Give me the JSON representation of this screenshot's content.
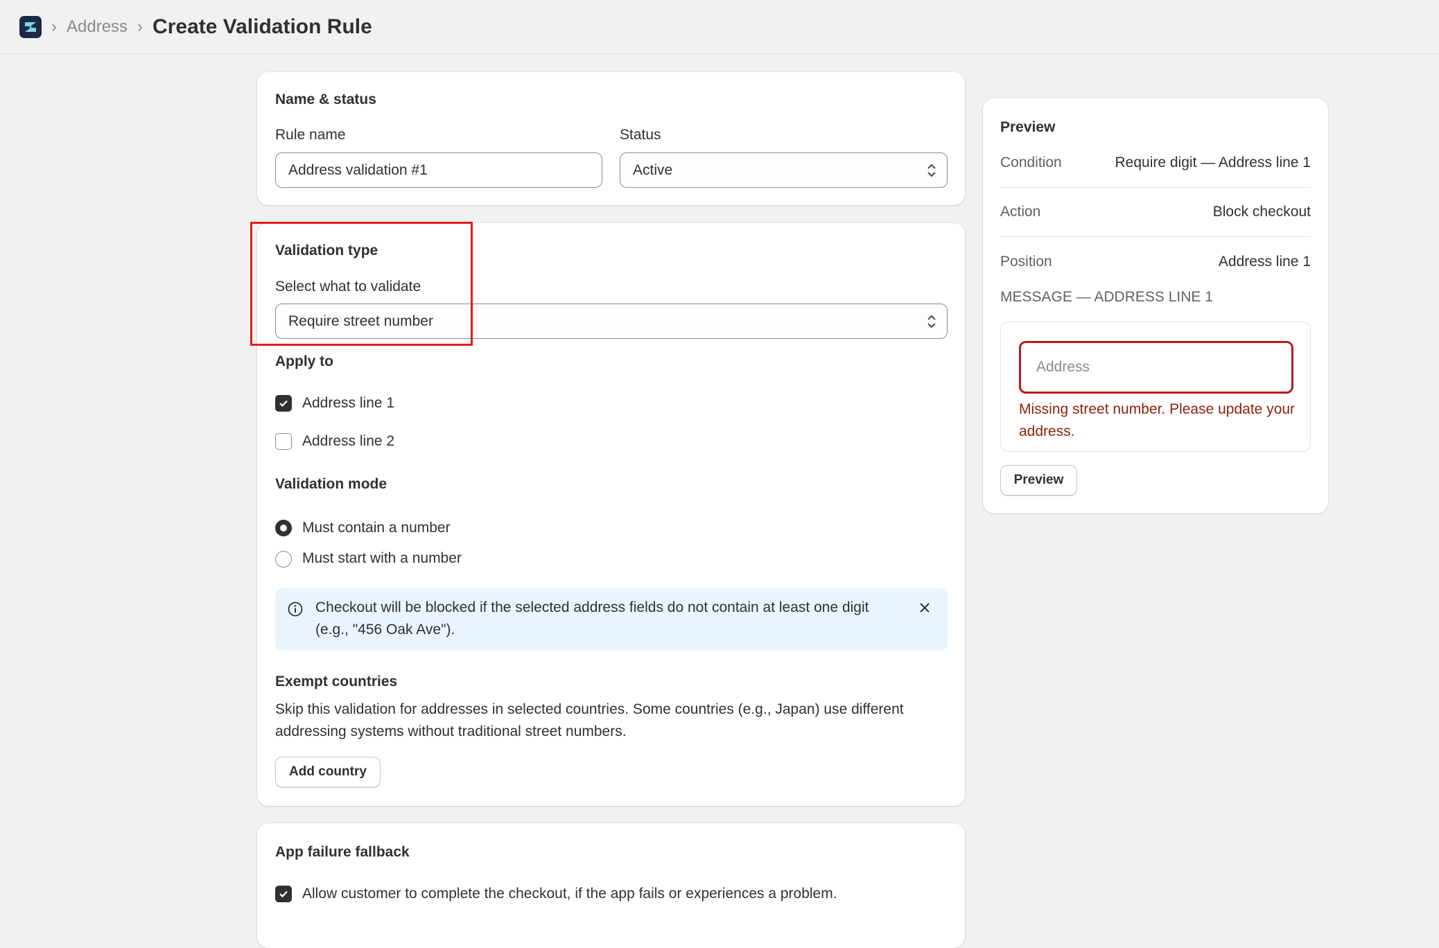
{
  "breadcrumb": {
    "parent": "Address",
    "current": "Create Validation Rule"
  },
  "name_status": {
    "title": "Name & status",
    "rule_name_label": "Rule name",
    "rule_name_value": "Address validation #1",
    "status_label": "Status",
    "status_value": "Active"
  },
  "validation_type": {
    "title": "Validation type",
    "select_label": "Select what to validate",
    "select_value": "Require street number",
    "apply_to_title": "Apply to",
    "apply_to": [
      {
        "label": "Address line 1",
        "checked": true
      },
      {
        "label": "Address line 2",
        "checked": false
      }
    ],
    "mode_title": "Validation mode",
    "modes": [
      {
        "label": "Must contain a number",
        "selected": true
      },
      {
        "label": "Must start with a number",
        "selected": false
      }
    ],
    "banner_text": "Checkout will be blocked if the selected address fields do not contain at least one digit (e.g., \"456 Oak Ave\").",
    "exempt_title": "Exempt countries",
    "exempt_desc": "Skip this validation for addresses in selected countries. Some countries (e.g., Japan) use different addressing systems without traditional street numbers.",
    "add_country_label": "Add country"
  },
  "fallback": {
    "title": "App failure fallback",
    "checkbox_label": "Allow customer to complete the checkout, if the app fails or experiences a problem.",
    "checked": true
  },
  "preview": {
    "title": "Preview",
    "rows": [
      {
        "key": "Condition",
        "value": "Require digit — Address line 1"
      },
      {
        "key": "Action",
        "value": "Block checkout"
      },
      {
        "key": "Position",
        "value": "Address line 1"
      }
    ],
    "message_heading": "MESSAGE — ADDRESS LINE 1",
    "input_placeholder": "Address",
    "error_text": "Missing street number. Please update your address.",
    "button_label": "Preview"
  },
  "colors": {
    "error": "#8e1f0b",
    "highlight": "#e31b1b",
    "banner_bg": "#eaf4ff",
    "checked_fill": "#303030"
  }
}
